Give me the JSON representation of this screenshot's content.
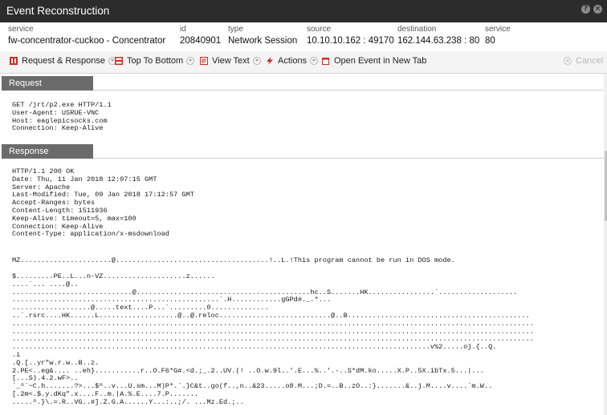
{
  "window": {
    "title": "Event Reconstruction",
    "help_icon": "help-icon",
    "close_icon": "close-icon"
  },
  "meta": [
    {
      "label": "service",
      "value": "fw-concentrator-cuckoo - Concentrator"
    },
    {
      "label": "id",
      "value": "20840901"
    },
    {
      "label": "type",
      "value": "Network Session"
    },
    {
      "label": "source",
      "value": "10.10.10.162 : 49170"
    },
    {
      "label": "destination",
      "value": "162.144.63.238 : 80"
    },
    {
      "label": "service",
      "value": "80"
    }
  ],
  "toolbar": {
    "request_response": "Request & Response",
    "top_to_bottom": "Top To Bottom",
    "view_text": "View Text",
    "actions": "Actions",
    "open_new_tab": "Open Event in New Tab",
    "cancel": "Cancel"
  },
  "colors": {
    "titlebar": "#2c2c2c",
    "section_header": "#6b6b6b",
    "icon_red": "#d02b20"
  },
  "request": {
    "header": "Request",
    "body": "GET /jrt/p2.exe HTTP/1.1\nUser-Agent: USRUE-VNC\nHost: eaglepicsocks.com\nConnection: Keep-Alive"
  },
  "response": {
    "header": "Response",
    "headers_text": "HTTP/1.1 200 OK\nDate: Thu, 11 Jan 2018 12:07:15 GMT\nServer: Apache\nLast-Modified: Tue, 09 Jan 2018 17:12:57 GMT\nAccept-Ranges: bytes\nContent-Length: 1511936\nKeep-Alive: timeout=5, max=100\nConnection: Keep-Alive\nContent-Type: application/x-msdownload",
    "mz_line": "MZ......................@.....................................!..L.!This program cannot be run in DOS mode.",
    "binary_text": "$.........PE..L...n-VZ....................z......\n....`... ....@..\n.............................@..........................................hc..S.......HK................`...................\n..................................................`.H............gGPd#._.*...\n...................@.....text....P...`.........0..............\n..`.rsrc....HK......L...................@..@.reloc...........................@..B............................................\n..............................................................................................................................\n..............................................................................................................................\n..............................................................................................................................\n.....................................................................................................v%2.....oj.{..Q.\n.i\n.Q.[..yr\"w.r.w..B..z.\n2.PE<..eg&.... ..eh}...........r..O.F6*G#.<d.;_.2..UV.(! ..O.w.9l..'.E...%..'.-..S*dM.ko.....X.P..5X.ibTx.5...|...\n[...S).4.2.wF>..\n`_^`~C.h.......?>...$^..v...U.sm...M)P*.`.}C&t..go(f..,n..&23.....o8.M...;D.=..B..zO..:}.......&..j.M....v....`m.W..\n[.2m<.$.y.dKq\".x....F..m.|A.%.E....7.P.......\n.....^.}\\.=.R..VG..#].Z.G.A......Y...:..;/. ...Mz.Ed.;.."
  }
}
